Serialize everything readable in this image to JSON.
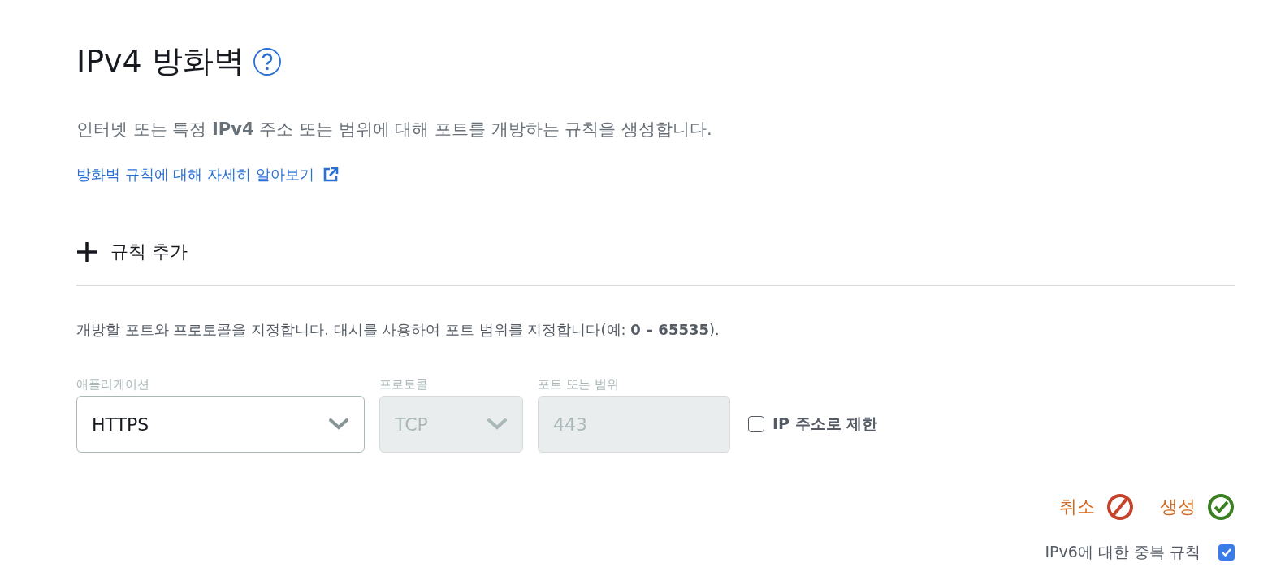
{
  "title": "IPv4 방화벽",
  "description": "인터넷 또는 특정 **IPv4** 주소 또는 범위에 대해 포트를 개방하는 규칙을 생성합니다.",
  "learn_more_link": "방화벽 규칙에 대해 자세히 알아보기",
  "add_rule": {
    "label": "규칙 추가"
  },
  "instructions": "개방할 포트와 프로토콜을 지정합니다. 대시를 사용하여 포트 범위를 지정합니다(예: **0 – 65535**).",
  "fields": [
    {
      "kind": "select",
      "label": "애플리케이션",
      "value": "HTTPS",
      "disabled": false
    },
    {
      "kind": "select",
      "label": "프로토콜",
      "value": "TCP",
      "disabled": true
    },
    {
      "kind": "text",
      "label": "포트 또는 범위",
      "value": "443",
      "disabled": true
    }
  ],
  "restrict_ip": {
    "label": "IP 주소로 제한",
    "checked": false
  },
  "actions": [
    {
      "kind": "cancel",
      "label": "취소"
    },
    {
      "kind": "create",
      "label": "생성"
    }
  ],
  "ipv6_duplicate": {
    "label": "IPv6에 대한 중복 규칙",
    "checked": true
  }
}
